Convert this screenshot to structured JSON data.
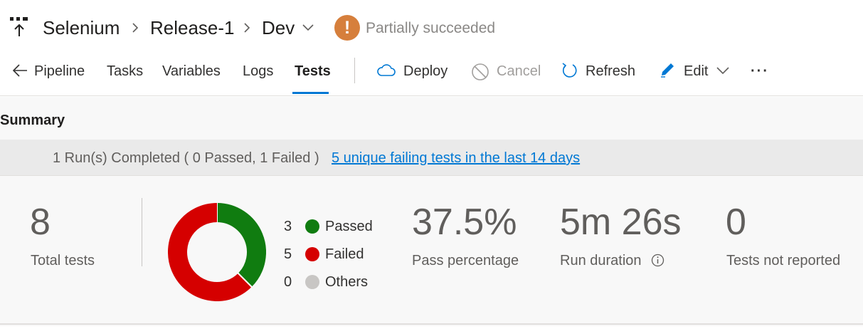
{
  "header": {
    "breadcrumb": [
      "Selenium",
      "Release-1",
      "Dev"
    ],
    "status": "Partially succeeded",
    "status_symbol": "!",
    "status_color": "#d67f3c"
  },
  "toolbar": {
    "back_label": "Pipeline",
    "tabs": [
      {
        "label": "Tasks",
        "active": false
      },
      {
        "label": "Variables",
        "active": false
      },
      {
        "label": "Logs",
        "active": false
      },
      {
        "label": "Tests",
        "active": true
      }
    ],
    "actions": [
      {
        "label": "Deploy",
        "icon": "cloud-icon",
        "enabled": true
      },
      {
        "label": "Cancel",
        "icon": "cancel-icon",
        "enabled": false
      },
      {
        "label": "Refresh",
        "icon": "refresh-icon",
        "enabled": true
      },
      {
        "label": "Edit",
        "icon": "edit-icon",
        "enabled": true
      }
    ],
    "more": "···",
    "accent_color": "#0078d4"
  },
  "summary": {
    "title": "Summary",
    "runs_text": "1 Run(s) Completed ( 0 Passed, 1 Failed )",
    "failing_link": "5 unique failing tests in the last 14 days",
    "total_tests": "8",
    "total_label": "Total tests",
    "legend": [
      {
        "count": "3",
        "label": "Passed",
        "color": "#107c10"
      },
      {
        "count": "5",
        "label": "Failed",
        "color": "#d50000"
      },
      {
        "count": "0",
        "label": "Others",
        "color": "#c8c6c4"
      }
    ],
    "pass_percentage": "37.5%",
    "pass_label": "Pass percentage",
    "run_duration": "5m 26s",
    "duration_label": "Run duration",
    "not_reported": "0",
    "not_reported_label": "Tests not reported"
  }
}
